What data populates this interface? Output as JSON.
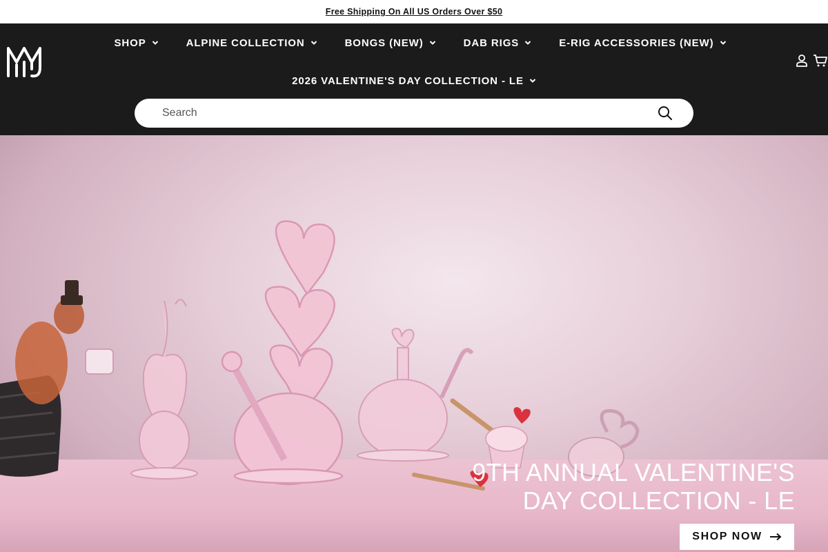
{
  "announcement": {
    "text": "Free Shipping On All US Orders Over $50"
  },
  "header": {
    "logo_icon": "mj-arsenal-logo-icon",
    "nav_row1": [
      {
        "label": "SHOP"
      },
      {
        "label": "ALPINE COLLECTION"
      },
      {
        "label": "BONGS (NEW)"
      },
      {
        "label": "DAB RIGS"
      },
      {
        "label": "E-RIG ACCESSORIES (NEW)"
      }
    ],
    "nav_row2": [
      {
        "label": "2026 VALENTINE'S DAY COLLECTION - LE"
      }
    ],
    "icons": {
      "account": "account-icon",
      "cart": "cart-icon"
    },
    "search": {
      "placeholder": "Search",
      "value": ""
    }
  },
  "hero": {
    "title_line1": "9TH ANNUAL VALENTINE'S",
    "title_line2": "DAY COLLECTION - LE",
    "cta_label": "SHOP NOW"
  },
  "colors": {
    "header_bg": "#1b1b1b",
    "announcement_bg": "#ffffff",
    "hero_pink": "#e7cfd9",
    "accent_red": "#d9333f"
  }
}
